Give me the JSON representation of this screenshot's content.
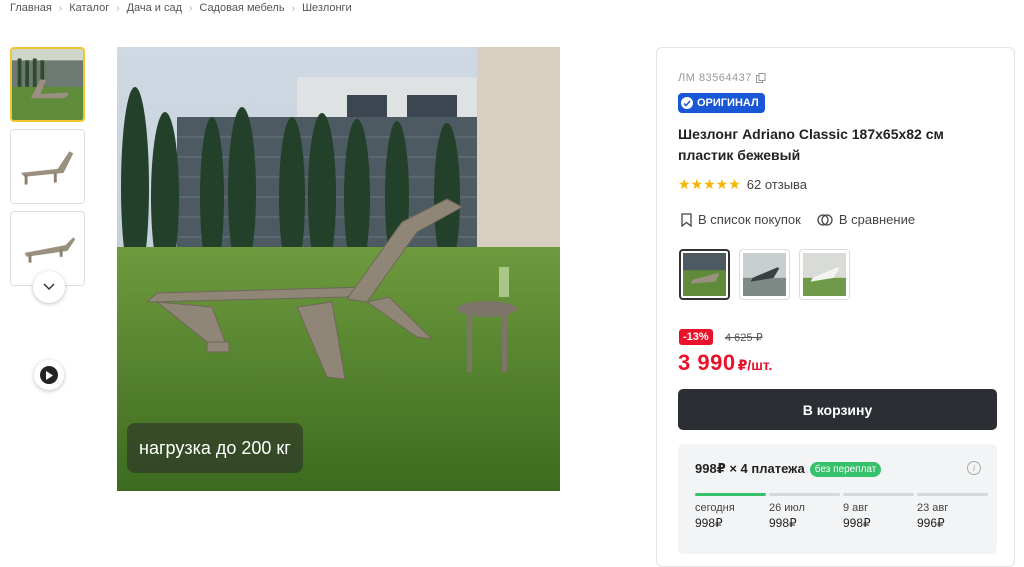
{
  "breadcrumb": [
    "Главная",
    "Каталог",
    "Дача и сад",
    "Садовая мебель",
    "Шезлонги"
  ],
  "gallery": {
    "overlay_text": "нагрузка до 200 кг"
  },
  "product": {
    "article": "ЛМ 83564437",
    "original_badge": "ОРИГИНАЛ",
    "title": "Шезлонг Adriano Classic 187x65x82 см пластик бежевый",
    "rating": {
      "stars": 5,
      "stars_text": "★★★★★",
      "reviews": "62 отзыва"
    },
    "actions": {
      "shopping_list": "В список покупок",
      "compare": "В сравнение"
    },
    "discount": "-13%",
    "old_price": "4 625 ₽",
    "price": "3 990",
    "price_unit": "₽/шт.",
    "cart_button": "В корзину"
  },
  "installments": {
    "title": "998₽ × 4 платежа",
    "badge": "без переплат",
    "info_icon": "i",
    "schedule": [
      {
        "date": "сегодня",
        "amount": "998₽",
        "paid": true
      },
      {
        "date": "26 июл",
        "amount": "998₽",
        "paid": false
      },
      {
        "date": "9 авг",
        "amount": "998₽",
        "paid": false
      },
      {
        "date": "23 авг",
        "amount": "996₽",
        "paid": false
      }
    ]
  },
  "colors": {
    "accent_red": "#e8132b",
    "badge_blue": "#1a57d6",
    "green": "#35c26a",
    "dark_button": "#2b2e33",
    "thumb_active": "#f4c430"
  }
}
